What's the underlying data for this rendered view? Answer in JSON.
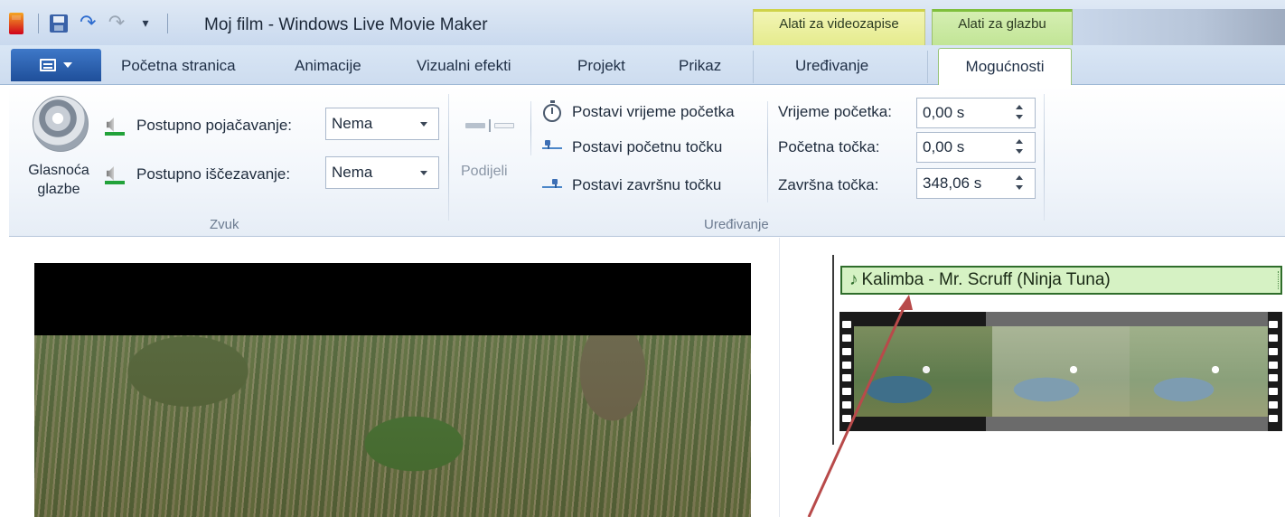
{
  "titlebar": {
    "title": "Moj film - Windows Live Movie Maker",
    "contextual_tabs": {
      "video": "Alati za videozapise",
      "music": "Alati za glazbu"
    }
  },
  "tabs": [
    {
      "label": "Početna stranica"
    },
    {
      "label": "Animacije"
    },
    {
      "label": "Vizualni efekti"
    },
    {
      "label": "Projekt"
    },
    {
      "label": "Prikaz"
    },
    {
      "label": "Uređivanje"
    },
    {
      "label": "Mogućnosti",
      "active": true
    }
  ],
  "ribbon": {
    "sound": {
      "music_volume_label": "Glasnoća glazbe",
      "fade_in_label": "Postupno pojačavanje:",
      "fade_in_value": "Nema",
      "fade_out_label": "Postupno iščezavanje:",
      "fade_out_value": "Nema",
      "group_label": "Zvuk"
    },
    "editing": {
      "split_label": "Podijeli",
      "set_start_time": "Postavi vrijeme početka",
      "set_start_point": "Postavi početnu točku",
      "set_end_point": "Postavi završnu točku",
      "start_time_label": "Vrijeme početka:",
      "start_time_value": "0,00 s",
      "start_point_label": "Početna točka:",
      "start_point_value": "0,00 s",
      "end_point_label": "Završna točka:",
      "end_point_value": "348,06 s",
      "group_label": "Uređivanje"
    }
  },
  "timeline": {
    "music_clip_title": "Kalimba - Mr. Scruff (Ninja Tuna)"
  },
  "colors": {
    "file_button": "#2a5fae",
    "context_video": "#e9ee9a",
    "context_music": "#c8e89e",
    "music_clip_bg": "#d6f2c4",
    "annotation_arrow": "#b84a4a"
  }
}
